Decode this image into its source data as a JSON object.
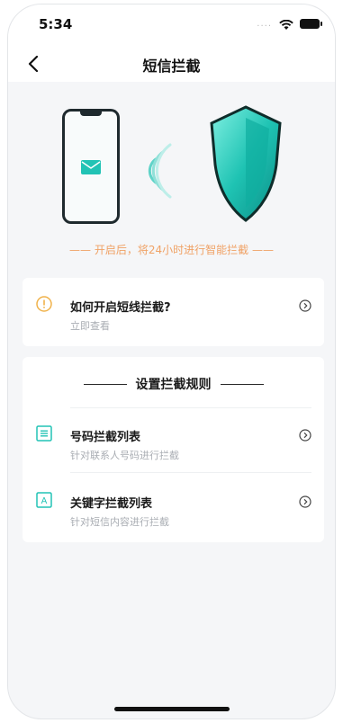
{
  "status_bar": {
    "time": "5:34",
    "dots": "····"
  },
  "navbar": {
    "title": "短信拦截"
  },
  "hero": {
    "slogan": "—— 开启后，将24小时进行智能拦截 ——"
  },
  "help": {
    "title": "如何开启短线拦截?",
    "subtitle": "立即查看"
  },
  "rules": {
    "title": "设置拦截规则",
    "items": [
      {
        "label": "号码拦截列表",
        "desc": "针对联系人号码进行拦截",
        "icon": "list-icon"
      },
      {
        "label": "关键字拦截列表",
        "desc": "针对短信内容进行拦截",
        "icon": "keyword-a-icon"
      }
    ]
  },
  "colors": {
    "accent_green": "#22c3b5",
    "slogan_orange": "#f0a266",
    "warning_icon": "#f0b24a"
  }
}
